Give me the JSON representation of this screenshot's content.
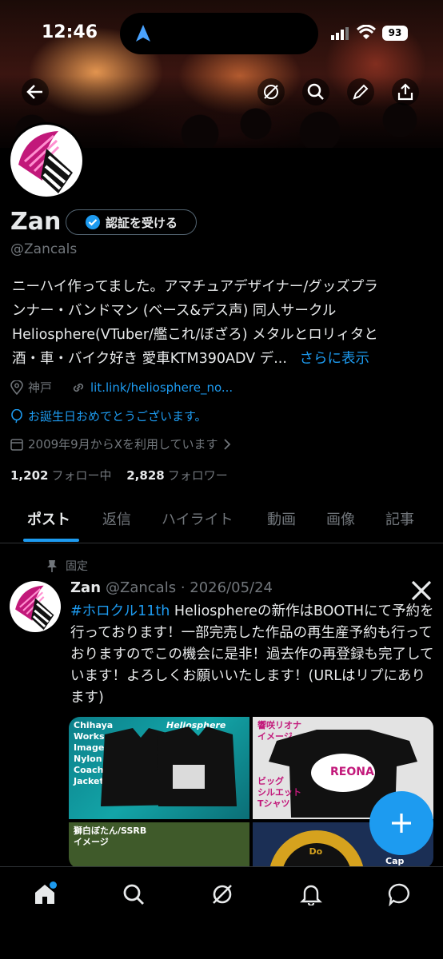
{
  "status": {
    "time": "12:46",
    "battery": "93"
  },
  "profile": {
    "name": "Zan",
    "verify_label": "認証を受ける",
    "handle": "@Zancals",
    "bio_lines": [
      "ニーハイ作ってました。アマチュアデザイナー/グッズプラ",
      "ンナー・バンドマン (ベース&デス声) 同人サークル",
      "Heliosphere(VTuber/艦これ/ぼざろ) メタルとロリィタと",
      "酒・車・バイク好き 愛車KTM390ADV デ..."
    ],
    "more_label": "さらに表示",
    "location": "神戸",
    "link": "lit.link/heliosphere_no...",
    "birthday": "お誕生日おめでとうございます。",
    "joined": "2009年9月からXを利用しています",
    "following_count": "1,202",
    "following_label": "フォロー中",
    "followers_count": "2,828",
    "followers_label": "フォロワー"
  },
  "tabs": [
    "ポスト",
    "返信",
    "ハイライト",
    "動画",
    "画像",
    "記事"
  ],
  "post": {
    "pinned_label": "固定",
    "author": "Zan",
    "meta": "@Zancals · 2026/05/24",
    "hashtag": "#ホロクル11th",
    "text_after_tag": " Heliosphereの新作はBOOTHにて予約を行っております！一部完売した作品の再生産予約も行っておりますのでこの機会に是非！過去作の再登録も完了しています！よろしくお願いいたします！(URLはリプにあります)",
    "media_labels": {
      "m1": "Chihaya\nWorks\nImage\nNylon\nCoach\nJacket",
      "m1_brand": "Heliosphere",
      "m2": "響咲リオナ\nイメージ",
      "m2_sub": "ビッグ\nシルエット\nTシャツ",
      "m2_logo": "REONA",
      "m3": "獅白ぼたん/SSRB\nイメージ",
      "m4": "Cap Sticker",
      "m4_badge": "RIN\nDo"
    }
  },
  "colors": {
    "accent": "#1d9bf0",
    "muted": "#71767b",
    "text": "#e7e9ea",
    "bg": "#000000"
  }
}
